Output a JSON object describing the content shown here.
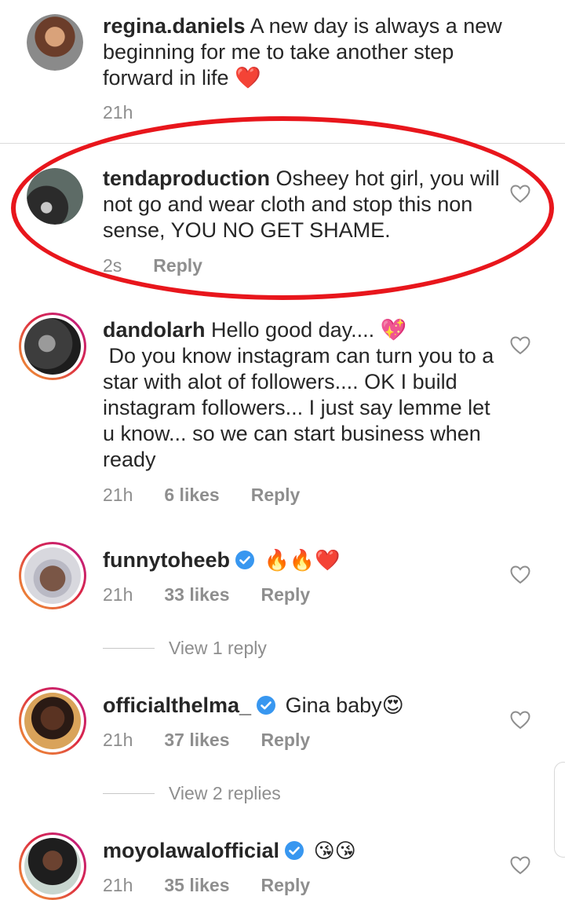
{
  "caption": {
    "username": "regina.daniels",
    "text": "A new day is always a new beginning for me to take another step forward in life ❤️",
    "time": "21h"
  },
  "comments": [
    {
      "username": "tendaproduction",
      "text": "Osheey hot girl, you will not go and wear cloth and stop this non sense, YOU NO GET SHAME.",
      "time": "2s",
      "likes": "",
      "reply_label": "Reply",
      "verified": false
    },
    {
      "username": "dandolarh",
      "text": "Hello good day.... 💖\n Do you know instagram can turn you to a star with alot of followers.... OK I build instagram followers... I just say lemme let u know... so we can start business when ready",
      "time": "21h",
      "likes": "6 likes",
      "reply_label": "Reply",
      "verified": false
    },
    {
      "username": "funnytoheeb",
      "text": "🔥🔥❤️",
      "time": "21h",
      "likes": "33 likes",
      "reply_label": "Reply",
      "verified": true,
      "view_replies": "View 1 reply"
    },
    {
      "username": "officialthelma_",
      "text": "Gina baby😍",
      "time": "21h",
      "likes": "37 likes",
      "reply_label": "Reply",
      "verified": true,
      "view_replies": "View 2 replies"
    },
    {
      "username": "moyolawalofficial",
      "text": "😘😘",
      "time": "21h",
      "likes": "35 likes",
      "reply_label": "Reply",
      "verified": true
    }
  ],
  "icons": {
    "like": "heart-outline-icon",
    "verified": "verified-badge-icon"
  },
  "colors": {
    "highlight": "#e8161c",
    "verified": "#3897f0",
    "secondary_text": "#8e8e8e",
    "text": "#262626"
  }
}
